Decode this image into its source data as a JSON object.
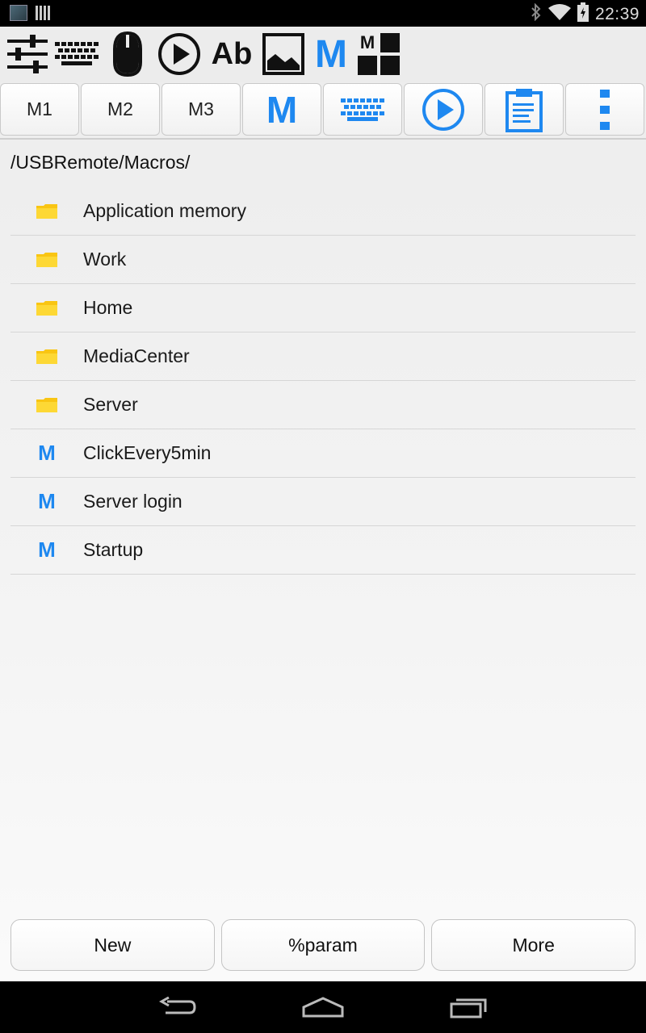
{
  "status_bar": {
    "time": "22:39",
    "icons": [
      "image-notification-icon",
      "barcode-notification-icon",
      "bluetooth-icon",
      "wifi-icon",
      "battery-icon"
    ]
  },
  "toolbar_icons": [
    "sliders-icon",
    "keyboard-icon",
    "mouse-icon",
    "play-icon",
    "text-ab-icon",
    "image-icon",
    "macro-m-icon",
    "macro-grid-icon"
  ],
  "toolbar_text": {
    "ab": "Ab",
    "m": "M",
    "grid_m": "M"
  },
  "tabs": [
    {
      "label": "M1"
    },
    {
      "label": "M2"
    },
    {
      "label": "M3"
    },
    {
      "label": "M",
      "icon": "macro-m-icon"
    },
    {
      "icon": "keyboard-icon"
    },
    {
      "icon": "play-icon"
    },
    {
      "icon": "clipboard-icon"
    },
    {
      "icon": "more-vertical-icon"
    }
  ],
  "path": "/USBRemote/Macros/",
  "items": [
    {
      "type": "folder",
      "label": "Application memory"
    },
    {
      "type": "folder",
      "label": "Work"
    },
    {
      "type": "folder",
      "label": "Home"
    },
    {
      "type": "folder",
      "label": "MediaCenter"
    },
    {
      "type": "folder",
      "label": "Server"
    },
    {
      "type": "macro",
      "icon_text": "M",
      "label": "ClickEvery5min"
    },
    {
      "type": "macro",
      "icon_text": "M",
      "label": "Server login"
    },
    {
      "type": "macro",
      "icon_text": "M",
      "label": "Startup"
    }
  ],
  "bottom_buttons": {
    "new": "New",
    "param": "%param",
    "more": "More"
  },
  "nav_bar": [
    "back-icon",
    "home-icon",
    "recent-apps-icon"
  ],
  "colors": {
    "accent_blue": "#1e88f0",
    "folder_yellow": "#fdd835"
  }
}
